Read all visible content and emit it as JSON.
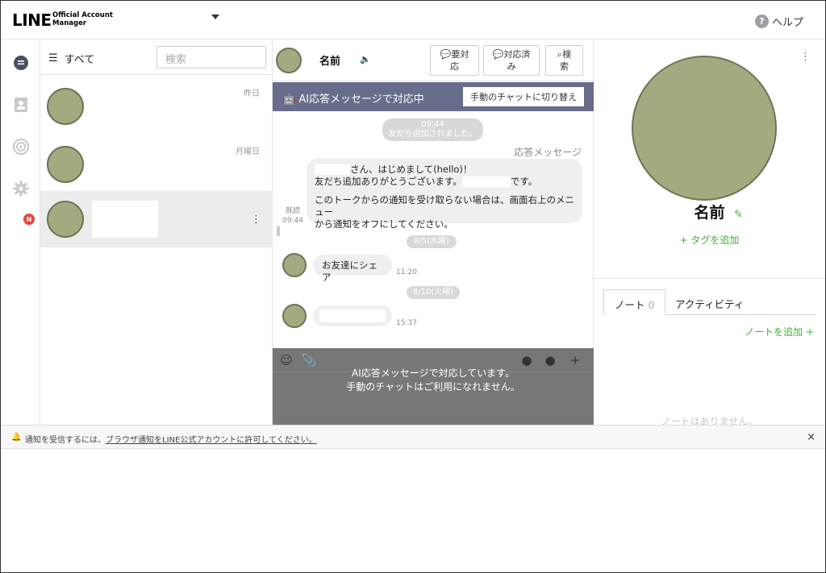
{
  "header": {
    "logo_main": "LINE",
    "logo_sub_line1": "Official Account",
    "logo_sub_line2": "Manager",
    "help_icon": "?",
    "help_label": "ヘルプ"
  },
  "rail": {
    "icons": [
      "chat-icon",
      "contacts-icon",
      "broadcast-icon",
      "settings-icon"
    ],
    "settings_badge": "N"
  },
  "chat_list": {
    "filter_label": "すべて",
    "search_placeholder": "検索",
    "items": [
      {
        "time": "昨日"
      },
      {
        "time": "月曜日"
      },
      {
        "time": ""
      }
    ]
  },
  "chat": {
    "name": "名前",
    "buttons": {
      "todo_l1": "要対",
      "todo_l2": "応",
      "done_l1": "対応済",
      "done_l2": "み",
      "search_l1": "検",
      "search_l2": "索"
    },
    "banner_text": "AI応答メッセージで対応中",
    "banner_button": "手動のチャットに切り替え",
    "system_time": "09:44",
    "system_added": "友だち追加されました。",
    "response_label": "応答メッセージ",
    "greeting_l1_suffix": "さん、はじめまして(hello)！",
    "greeting_l2_prefix": "友だち追加ありがとうございます。",
    "greeting_l2_suffix": "です。",
    "greeting_l3": "このトークからの通知を受け取らない場合は、画面右上のメニュー",
    "greeting_l4": "から通知をオフにしてください。",
    "read_label": "既読",
    "read_time": "09:44",
    "date1": "8/5(木曜)",
    "msg1": "お友達にシェア",
    "msg1_time": "11:20",
    "date2": "8/10(火曜)",
    "msg2_time": "15:37",
    "composer_line1": "AI応答メッセージで対応しています。",
    "composer_line2": "手動のチャットはご利用になれません。"
  },
  "profile": {
    "name": "名前",
    "add_tag": "+ タグを追加",
    "tab_note": "ノート",
    "tab_note_count": "0",
    "tab_activity": "アクティビティ",
    "add_note": "ノートを追加 +",
    "no_notes": "ノートはありません。"
  },
  "notification": {
    "prefix": "通知を受信するには、",
    "link": "ブラウザ通知をLINE公式アカウントに許可してください。",
    "close": "×"
  }
}
